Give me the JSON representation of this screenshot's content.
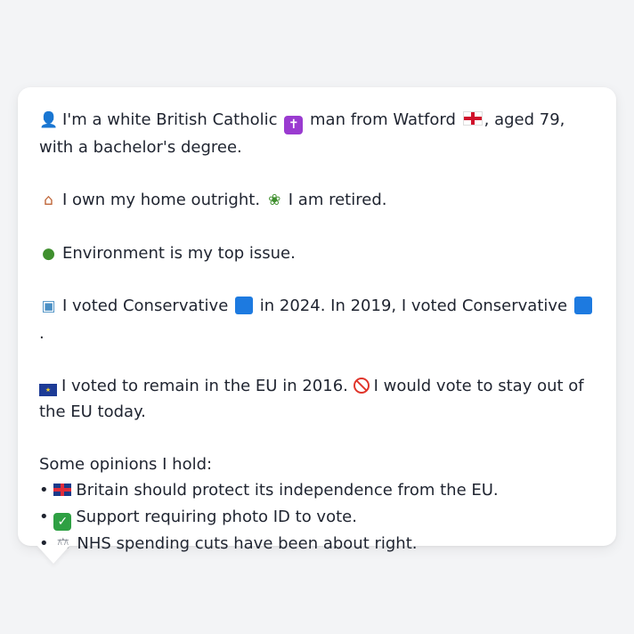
{
  "profile": {
    "line1": {
      "icon": "person-icon",
      "text_a": "I'm a white British Catholic",
      "text_b": "man from Watford",
      "text_c": ", aged 79, with a bachelor's degree."
    },
    "line2": {
      "home_icon": "house-icon",
      "home_text": "I own my home outright.",
      "retired_icon": "palm-tree-icon",
      "retired_text": "I am retired."
    },
    "line3": {
      "icon": "tree-icon",
      "text": "Environment is my top issue."
    },
    "line4": {
      "icon": "ballot-box-icon",
      "text_a": "I voted Conservative",
      "text_b": "in 2024. In 2019, I voted Conservative",
      "text_c": ".",
      "party_color": "#1d7ae0"
    },
    "line5": {
      "icon": "eu-flag-icon",
      "text_a": "I voted to remain in the EU in 2016.",
      "no_icon": "no-entry-icon",
      "text_b": "I would vote to stay out of the EU today."
    },
    "opinions_heading": "Some opinions I hold:",
    "opinions": [
      {
        "bullet": "•",
        "icon": "uk-flag-icon",
        "text": "Britain should protect its independence from the EU."
      },
      {
        "bullet": "•",
        "icon": "check-mark-icon",
        "text": "Support requiring photo ID to vote."
      },
      {
        "bullet": "•",
        "icon": "balance-scale-icon",
        "text": "NHS spending cuts have been about right."
      }
    ]
  }
}
